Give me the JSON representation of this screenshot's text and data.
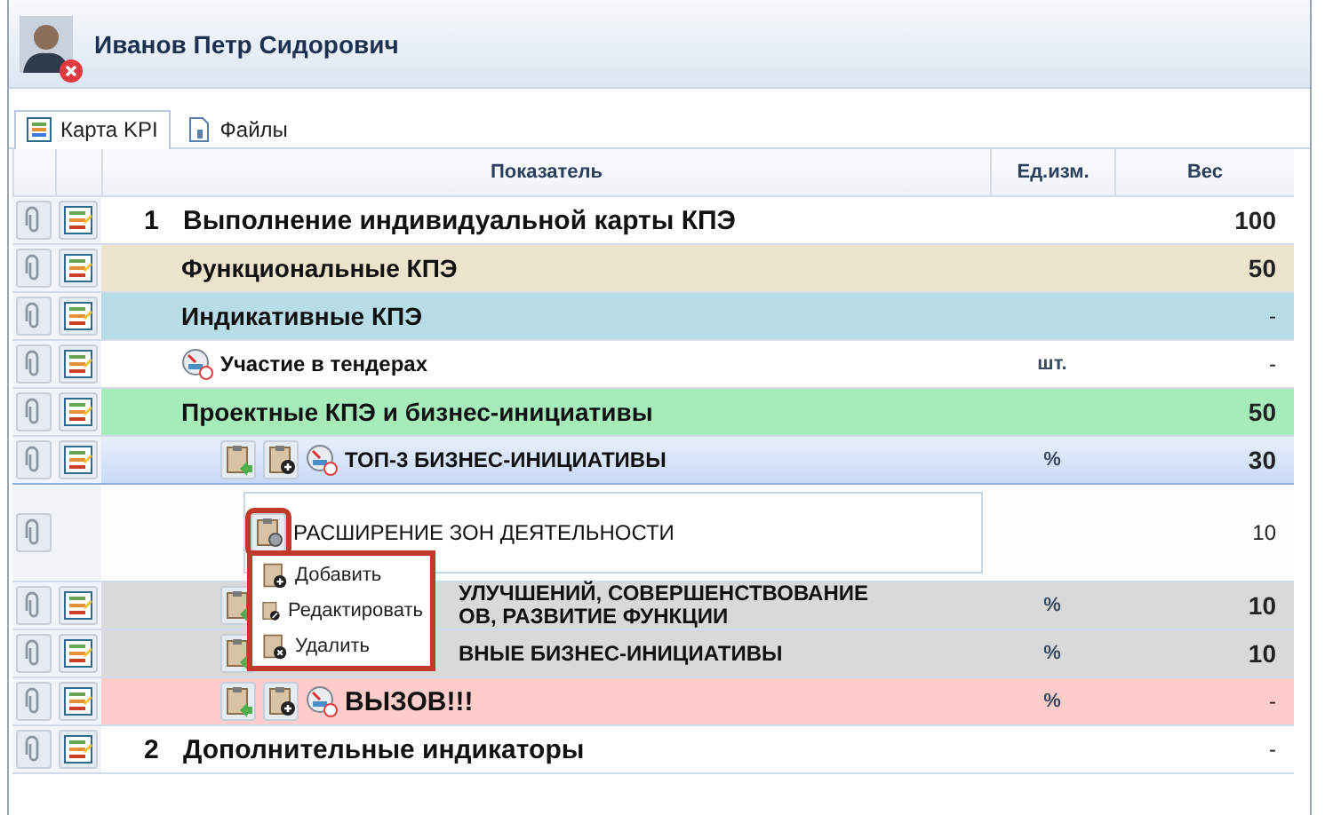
{
  "user": {
    "name": "Иванов Петр Сидорович"
  },
  "tabs": [
    {
      "label": "Карта KPI",
      "kind": "kpi",
      "selected": true
    },
    {
      "label": "Файлы",
      "kind": "files",
      "selected": false
    }
  ],
  "columns": [
    "Показатель",
    "Ед.изм.",
    "Вес"
  ],
  "rows": [
    {
      "kind": "section",
      "number": "1",
      "label": "Выполнение индивидуальной карты КПЭ",
      "unit": "",
      "weight": "100",
      "selected": false
    },
    {
      "kind": "group",
      "label": "Функциональные КПЭ",
      "unit": "",
      "weight": "50",
      "color": "#ebe3cb",
      "selected": false
    },
    {
      "kind": "group",
      "label": "Индикативные КПЭ",
      "unit": "",
      "weight": "-",
      "color": "#b7dde7",
      "selected": false
    },
    {
      "kind": "item",
      "tools": [
        {
          "kind": "gauge"
        }
      ],
      "label": "Участие в тендерах",
      "unit": "шт.",
      "weight": "-",
      "selected": false
    },
    {
      "kind": "group",
      "label": "Проектные КПЭ и бизнес-инициативы",
      "unit": "",
      "weight": "50",
      "color": "#a6ecbb",
      "selected": false
    },
    {
      "kind": "initiative",
      "tools": [
        {
          "kind": "move"
        },
        {
          "kind": "add"
        },
        {
          "kind": "gauge"
        }
      ],
      "label": "ТОП-3 БИЗНЕС-ИНИЦИАТИВЫ",
      "unit": "%",
      "weight": "30",
      "selected": true
    },
    {
      "kind": "detail",
      "sub": {
        "kind": "edit",
        "label": "РАСШИРЕНИЕ ЗОН ДЕЯТЕЛЬНОСТИ",
        "selected": true
      },
      "unit": "",
      "weight": "10",
      "selected": false
    },
    {
      "kind": "covered",
      "tools": [
        {
          "kind": "move"
        }
      ],
      "label": "УЛУЧШЕНИЙ, СОВЕРШЕНСТВОВАНИЕ\nОВ, РАЗВИТИЕ ФУНКЦИИ",
      "unit": "%",
      "weight": "10",
      "color": "#d9d9d9",
      "selected": false
    },
    {
      "kind": "covered",
      "tools": [
        {
          "kind": "move"
        }
      ],
      "label": "ВНЫЕ БИЗНЕС-ИНИЦИАТИВЫ",
      "unit": "%",
      "weight": "10",
      "color": "#d9d9d9",
      "selected": false
    },
    {
      "kind": "initiative",
      "tools": [
        {
          "kind": "move"
        },
        {
          "kind": "add"
        },
        {
          "kind": "gauge"
        }
      ],
      "label": "ВЫЗОВ!!!",
      "unit": "%",
      "weight": "-",
      "color": "#ffcccc",
      "selected": false
    },
    {
      "kind": "section",
      "number": "2",
      "label": "Дополнительные индикаторы",
      "unit": "",
      "weight": "-",
      "selected": false
    }
  ],
  "context_menu": {
    "items": [
      {
        "kind": "add",
        "label": "Добавить"
      },
      {
        "kind": "edit",
        "label": "Редактировать"
      },
      {
        "kind": "delete",
        "label": "Удалить"
      }
    ]
  }
}
